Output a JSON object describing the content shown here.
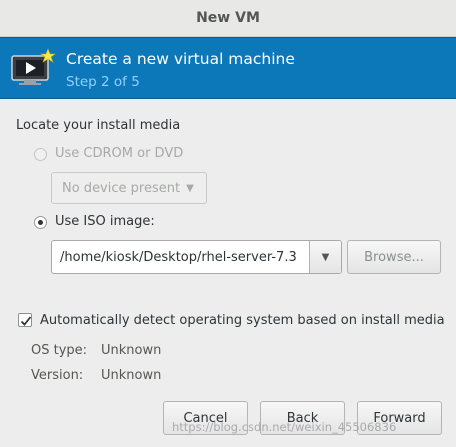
{
  "window": {
    "title": "New VM"
  },
  "banner": {
    "title": "Create a new virtual machine",
    "step": "Step 2 of 5",
    "icon": "vm-create-icon"
  },
  "install_media": {
    "section_label": "Locate your install media",
    "cdrom": {
      "label": "Use CDROM or DVD",
      "selected": false,
      "enabled": false,
      "device_value": "No device present"
    },
    "iso": {
      "label": "Use ISO image:",
      "selected": true,
      "path_value": "/home/kiosk/Desktop/rhel-server-7.3",
      "browse_label": "Browse..."
    }
  },
  "os_detect": {
    "checkbox_label": "Automatically detect operating system based on install media",
    "checked": true,
    "os_type_label": "OS type:",
    "os_type_value": "Unknown",
    "version_label": "Version:",
    "version_value": "Unknown"
  },
  "buttons": {
    "cancel": "Cancel",
    "back": "Back",
    "forward": "Forward"
  },
  "watermark": "https://blog.csdn.net/weixin_45506836",
  "colors": {
    "banner": "#0c78b9",
    "banner_subtitle": "#8fd0ff",
    "background": "#ededed"
  }
}
